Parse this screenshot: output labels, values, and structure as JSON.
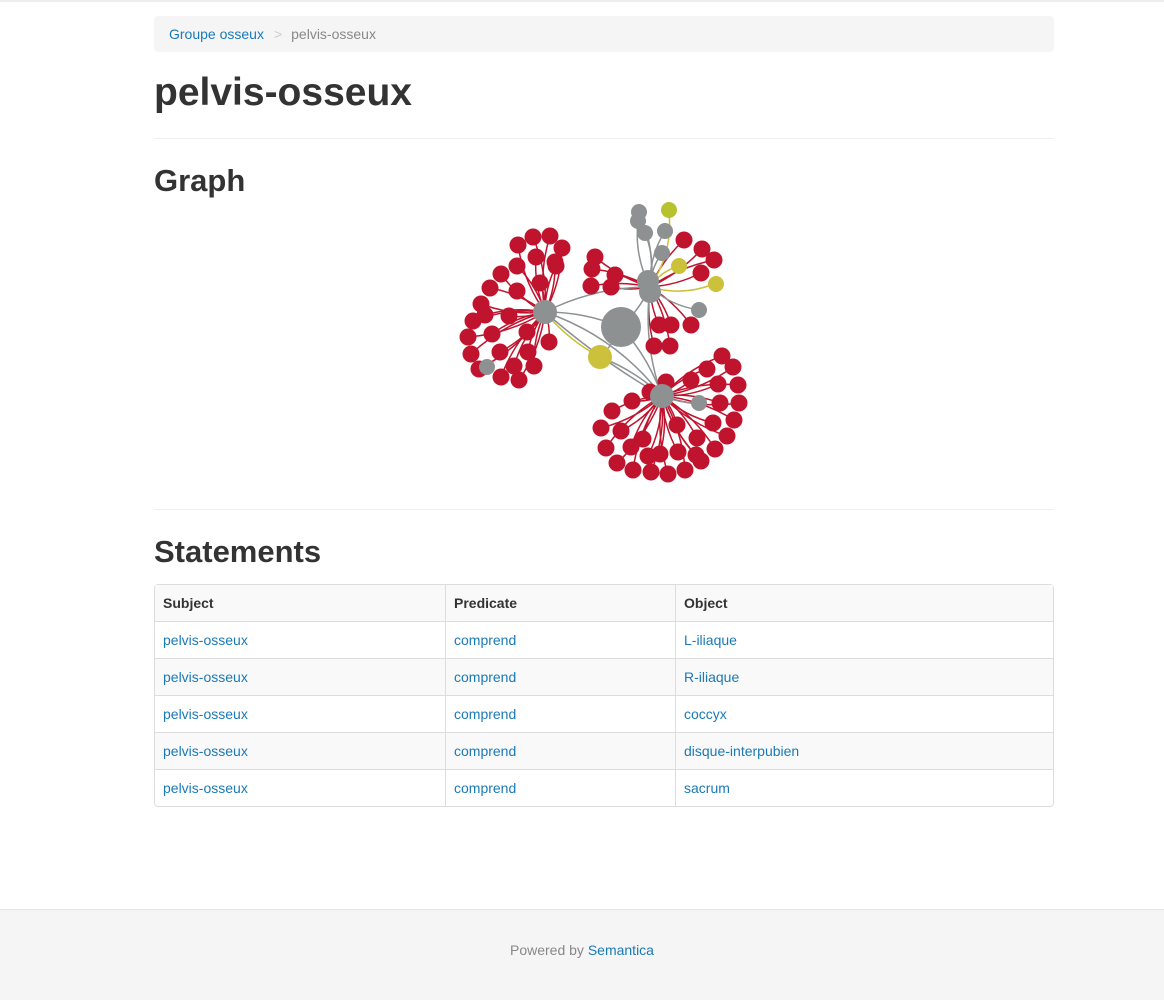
{
  "breadcrumb": {
    "parent_label": "Groupe osseux",
    "separator": ">",
    "current_label": "pelvis-osseux"
  },
  "page_title": "pelvis-osseux",
  "graph": {
    "title": "Graph",
    "colors": {
      "edge_red": "#c0132d",
      "edge_gray": "#8d9192",
      "edge_yellow": "#cbc13a",
      "node_red": "#c0132d",
      "node_gray": "#8d9192",
      "node_yellow": "#cbc13a",
      "node_lime": "#b7c32e"
    }
  },
  "statements": {
    "title": "Statements",
    "headers": [
      "Subject",
      "Predicate",
      "Object"
    ],
    "rows": [
      [
        "pelvis-osseux",
        "comprend",
        "L-iliaque"
      ],
      [
        "pelvis-osseux",
        "comprend",
        "R-iliaque"
      ],
      [
        "pelvis-osseux",
        "comprend",
        "coccyx"
      ],
      [
        "pelvis-osseux",
        "comprend",
        "disque-interpubien"
      ],
      [
        "pelvis-osseux",
        "comprend",
        "sacrum"
      ]
    ]
  },
  "footer": {
    "prefix": "Powered by",
    "link_label": "Semantica"
  }
}
